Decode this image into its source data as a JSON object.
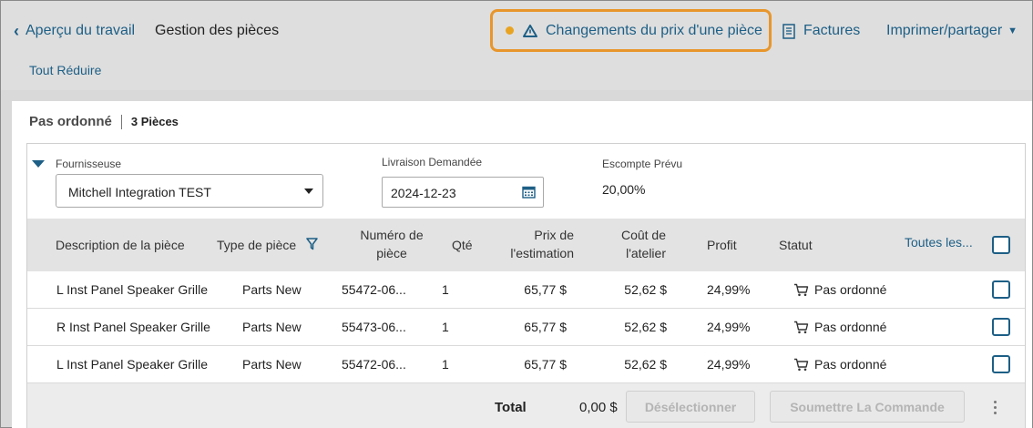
{
  "header": {
    "back_label": "Aperçu du travail",
    "current_label": "Gestion des pièces",
    "collapse_all": "Tout Réduire",
    "price_change_label": "Changements du prix d'une pièce",
    "invoices_label": "Factures",
    "print_share_label": "Imprimer/partager"
  },
  "group": {
    "status": "Pas ordonné",
    "count": "3 Pièces"
  },
  "supplier": {
    "label": "Fournisseuse",
    "value": "Mitchell Integration TEST"
  },
  "delivery": {
    "label": "Livraison Demandée",
    "value": "2024-12-23"
  },
  "discount": {
    "label": "Escompte Prévu",
    "value": "20,00%"
  },
  "table": {
    "columns": {
      "description": "Description de la pièce",
      "type": "Type de pièce",
      "number_l1": "Numéro de",
      "number_l2": "pièce",
      "qty": "Qté",
      "est_price_l1": "Prix de",
      "est_price_l2": "l'estimation",
      "shop_cost_l1": "Coût de",
      "shop_cost_l2": "l'atelier",
      "profit": "Profit",
      "status": "Statut",
      "all": "Toutes les..."
    },
    "rows": [
      {
        "description": "L Inst Panel Speaker Grille",
        "type": "Parts New",
        "number": "55472-06...",
        "qty": "1",
        "est_price": "65,77 $",
        "shop_cost": "52,62 $",
        "profit": "24,99%",
        "status": "Pas ordonné"
      },
      {
        "description": "R Inst Panel Speaker Grille",
        "type": "Parts New",
        "number": "55473-06...",
        "qty": "1",
        "est_price": "65,77 $",
        "shop_cost": "52,62 $",
        "profit": "24,99%",
        "status": "Pas ordonné"
      },
      {
        "description": "L Inst Panel Speaker Grille",
        "type": "Parts New",
        "number": "55472-06...",
        "qty": "1",
        "est_price": "65,77 $",
        "shop_cost": "52,62 $",
        "profit": "24,99%",
        "status": "Pas ordonné"
      }
    ]
  },
  "footer": {
    "total_label": "Total",
    "total_value": "0,00 $",
    "deselect_label": "Désélectionner",
    "submit_label": "Soumettre La Commande"
  },
  "colors": {
    "link": "#1d5f86",
    "highlight_border": "#e8962b",
    "warning_dot": "#e8a321"
  }
}
